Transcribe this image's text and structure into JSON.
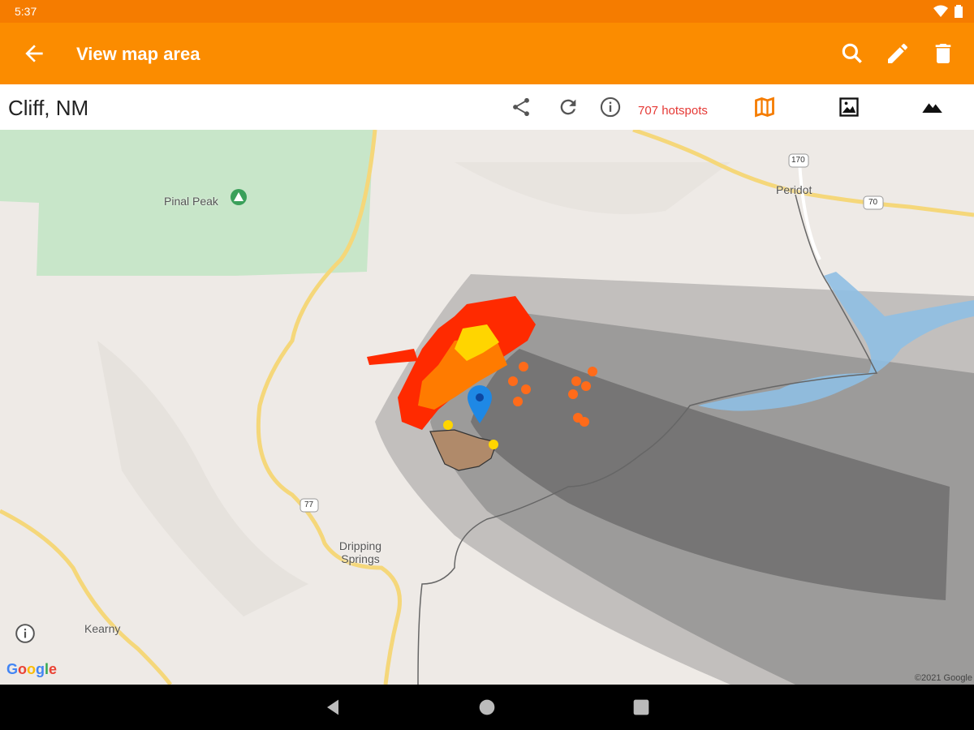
{
  "status_bar": {
    "time": "5:37"
  },
  "app_bar": {
    "title": "View map area",
    "actions": [
      "search-icon",
      "edit-icon",
      "delete-icon"
    ]
  },
  "toolbar": {
    "location": "Cliff, NM",
    "hotspots": "707 hotspots",
    "icons": [
      "share-icon",
      "refresh-icon",
      "info-icon",
      "map-layer-icon",
      "satellite-layer-icon",
      "terrain-layer-icon"
    ],
    "active_color": "#f57c00"
  },
  "map": {
    "labels": {
      "peak": "Pinal Peak",
      "town1": "Peridot",
      "town2": "Dripping Springs",
      "town3": "Kearny"
    },
    "shields": {
      "route1": "170",
      "route2": "70",
      "route3": "77"
    },
    "google_logo": "Google",
    "copyright": "©2021 Google",
    "colors": {
      "forest": "#c8e6c9",
      "road": "#f5d77a",
      "water": "#8fbfe3",
      "fire": "#ff2a00",
      "fire_mid": "#ff7b00",
      "fire_young": "#ffd500",
      "smoke": "#555555",
      "marker": "#1e88e5"
    }
  },
  "nav_bar": {
    "buttons": [
      "back-nav-icon",
      "home-nav-icon",
      "recents-nav-icon"
    ]
  }
}
